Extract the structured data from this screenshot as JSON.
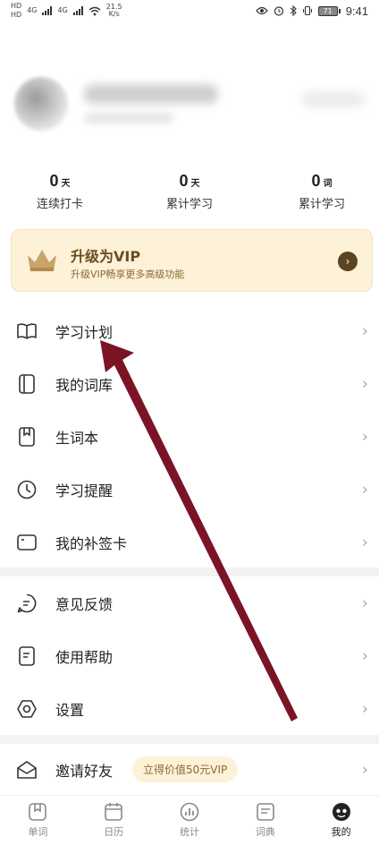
{
  "status": {
    "net_top": "HD",
    "net_bottom": "HD",
    "signal1": "4G",
    "signal2": "4G",
    "speed_value": "21.5",
    "speed_unit": "K/s",
    "battery": "71",
    "time": "9:41"
  },
  "stats": [
    {
      "value": "0",
      "unit": "天",
      "label": "连续打卡"
    },
    {
      "value": "0",
      "unit": "天",
      "label": "累计学习"
    },
    {
      "value": "0",
      "unit": "词",
      "label": "累计学习"
    }
  ],
  "vip": {
    "title": "升级为VIP",
    "subtitle": "升级VIP畅享更多高级功能",
    "arrow": "›"
  },
  "menu_group1": [
    {
      "label": "学习计划",
      "icon": "book-open-icon"
    },
    {
      "label": "我的词库",
      "icon": "library-icon"
    },
    {
      "label": "生词本",
      "icon": "notebook-icon"
    },
    {
      "label": "学习提醒",
      "icon": "clock-icon"
    },
    {
      "label": "我的补签卡",
      "icon": "card-icon"
    }
  ],
  "menu_group2": [
    {
      "label": "意见反馈",
      "icon": "feedback-icon"
    },
    {
      "label": "使用帮助",
      "icon": "help-doc-icon"
    },
    {
      "label": "设置",
      "icon": "settings-icon"
    }
  ],
  "invite": {
    "label": "邀请好友",
    "pill": "立得价值50元VIP"
  },
  "chevron": "›",
  "tabs": [
    {
      "label": "单词",
      "icon": "word-tab-icon",
      "active": false
    },
    {
      "label": "日历",
      "icon": "calendar-tab-icon",
      "active": false
    },
    {
      "label": "统计",
      "icon": "stats-tab-icon",
      "active": false
    },
    {
      "label": "词典",
      "icon": "dictionary-tab-icon",
      "active": false
    },
    {
      "label": "我的",
      "icon": "profile-tab-icon",
      "active": true
    }
  ],
  "colors": {
    "vip_bg": "#fdf1d8",
    "vip_text": "#6b4d1e",
    "annotation_arrow": "#7a1424"
  }
}
